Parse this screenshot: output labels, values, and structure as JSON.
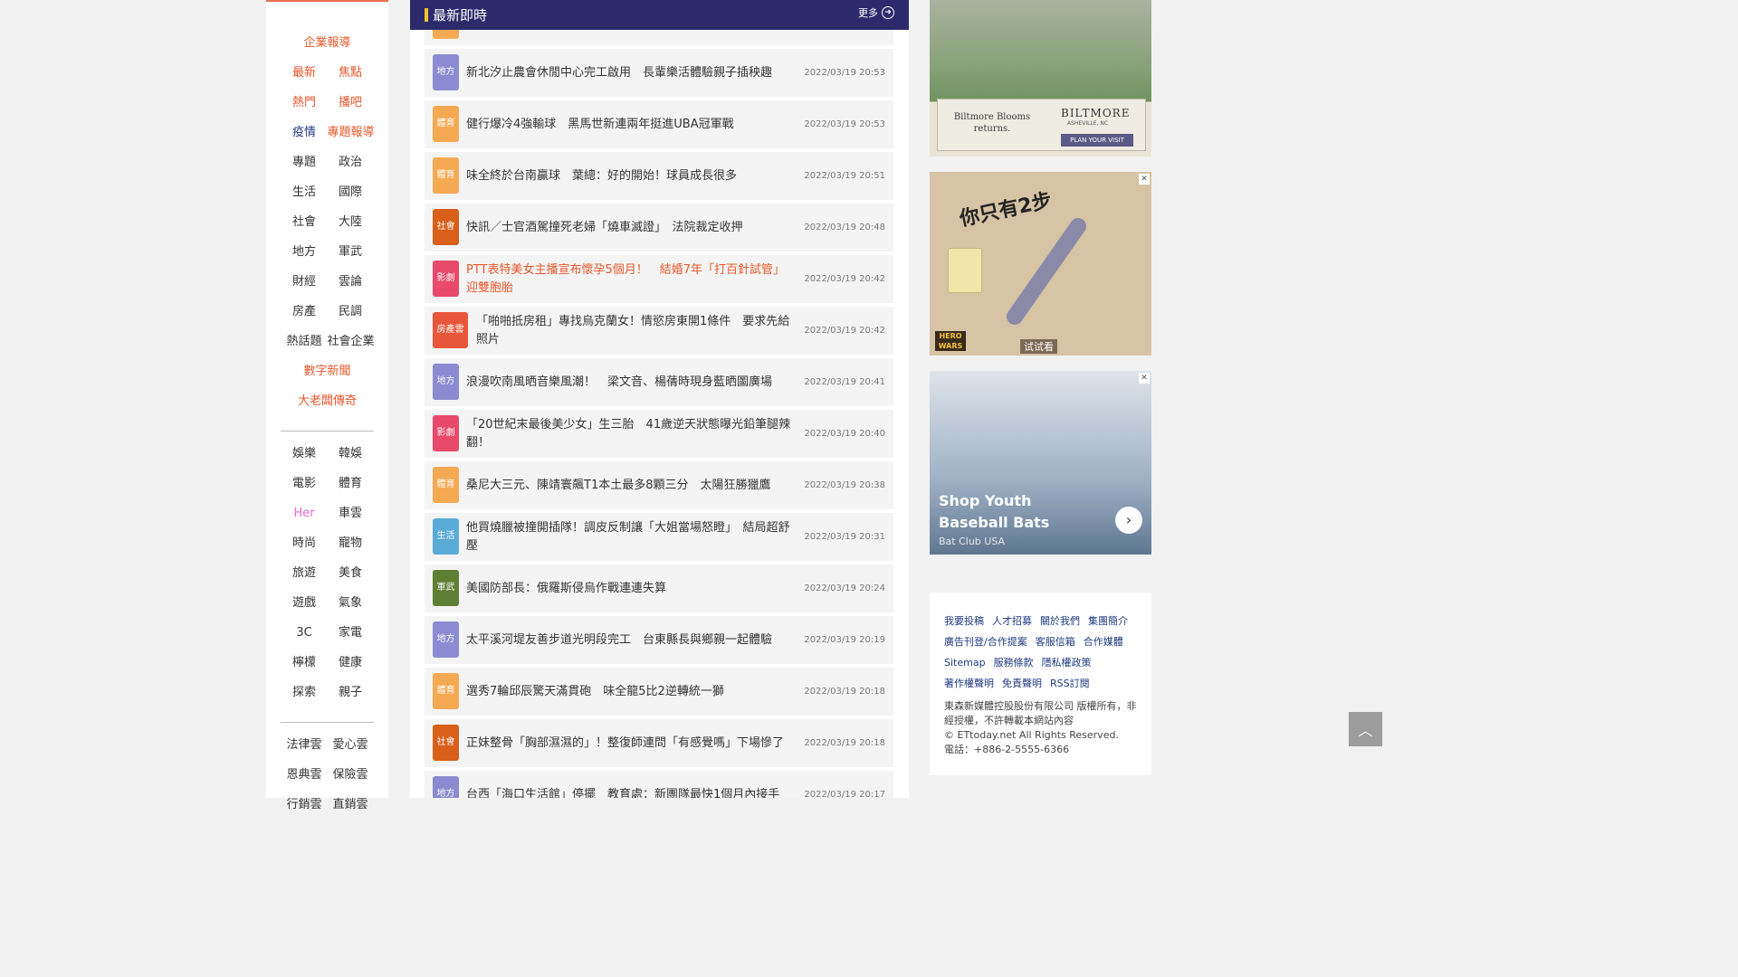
{
  "sidebar": {
    "groups": [
      [
        {
          "type": "single",
          "items": [
            {
              "label": "企業報導",
              "color": "orange"
            }
          ]
        },
        {
          "type": "pair",
          "items": [
            {
              "label": "最新",
              "color": "orange"
            },
            {
              "label": "焦點",
              "color": "orange"
            }
          ]
        },
        {
          "type": "pair",
          "items": [
            {
              "label": "熱門",
              "color": "orange"
            },
            {
              "label": "播吧",
              "color": "orange"
            }
          ]
        },
        {
          "type": "pair",
          "items": [
            {
              "label": "疫情",
              "color": "navy"
            },
            {
              "label": "專題報導",
              "color": "orange"
            }
          ]
        },
        {
          "type": "pair",
          "items": [
            {
              "label": "專題",
              "color": "dark"
            },
            {
              "label": "政治",
              "color": "dark"
            }
          ]
        },
        {
          "type": "pair",
          "items": [
            {
              "label": "生活",
              "color": "dark"
            },
            {
              "label": "國際",
              "color": "dark"
            }
          ]
        },
        {
          "type": "pair",
          "items": [
            {
              "label": "社會",
              "color": "dark"
            },
            {
              "label": "大陸",
              "color": "dark"
            }
          ]
        },
        {
          "type": "pair",
          "items": [
            {
              "label": "地方",
              "color": "dark"
            },
            {
              "label": "軍武",
              "color": "dark"
            }
          ]
        },
        {
          "type": "pair",
          "items": [
            {
              "label": "財經",
              "color": "dark"
            },
            {
              "label": "雲論",
              "color": "dark"
            }
          ]
        },
        {
          "type": "pair",
          "items": [
            {
              "label": "房產",
              "color": "dark"
            },
            {
              "label": "民調",
              "color": "dark"
            }
          ]
        },
        {
          "type": "pair",
          "items": [
            {
              "label": "熱話題",
              "color": "dark"
            },
            {
              "label": "社會企業",
              "color": "dark"
            }
          ]
        },
        {
          "type": "single",
          "items": [
            {
              "label": "數字新聞",
              "color": "orange"
            }
          ]
        },
        {
          "type": "single",
          "items": [
            {
              "label": "大老闆傳奇",
              "color": "orange"
            }
          ]
        }
      ],
      [
        {
          "type": "pair",
          "items": [
            {
              "label": "娛樂",
              "color": "dark"
            },
            {
              "label": "韓娛",
              "color": "dark"
            }
          ]
        },
        {
          "type": "pair",
          "items": [
            {
              "label": "電影",
              "color": "dark"
            },
            {
              "label": "體育",
              "color": "dark"
            }
          ]
        },
        {
          "type": "pair",
          "items": [
            {
              "label": "Her",
              "color": "pink"
            },
            {
              "label": "車雲",
              "color": "dark"
            }
          ]
        },
        {
          "type": "pair",
          "items": [
            {
              "label": "時尚",
              "color": "dark"
            },
            {
              "label": "寵物",
              "color": "dark"
            }
          ]
        },
        {
          "type": "pair",
          "items": [
            {
              "label": "旅遊",
              "color": "dark"
            },
            {
              "label": "美食",
              "color": "dark"
            }
          ]
        },
        {
          "type": "pair",
          "items": [
            {
              "label": "遊戲",
              "color": "dark"
            },
            {
              "label": "氣象",
              "color": "dark"
            }
          ]
        },
        {
          "type": "pair",
          "items": [
            {
              "label": "3C",
              "color": "dark"
            },
            {
              "label": "家電",
              "color": "dark"
            }
          ]
        },
        {
          "type": "pair",
          "items": [
            {
              "label": "檸檬",
              "color": "dark"
            },
            {
              "label": "健康",
              "color": "dark"
            }
          ]
        },
        {
          "type": "pair",
          "items": [
            {
              "label": "探索",
              "color": "dark"
            },
            {
              "label": "親子",
              "color": "dark"
            }
          ]
        }
      ],
      [
        {
          "type": "pair",
          "items": [
            {
              "label": "法律雲",
              "color": "dark"
            },
            {
              "label": "愛心雲",
              "color": "dark"
            }
          ]
        },
        {
          "type": "pair",
          "items": [
            {
              "label": "恩典雲",
              "color": "dark"
            },
            {
              "label": "保險雲",
              "color": "dark"
            }
          ]
        },
        {
          "type": "pair",
          "items": [
            {
              "label": "行銷雲",
              "color": "dark"
            },
            {
              "label": "直銷雲",
              "color": "dark"
            }
          ]
        }
      ]
    ]
  },
  "main": {
    "title": "最新即時",
    "more_label": "更多",
    "news": [
      {
        "tag": "地方",
        "tag_type": "local",
        "title": "新北汐止農會休閒中心完工啟用　長輩樂活體驗親子插秧趣",
        "date": "2022/03/19 20:53"
      },
      {
        "tag": "體育",
        "tag_type": "sport",
        "title": "健行爆冷4強輸球　黑馬世新連兩年挺進UBA冠軍戰",
        "date": "2022/03/19 20:53"
      },
      {
        "tag": "體育",
        "tag_type": "sport",
        "title": "味全終於台南贏球　葉總：好的開始！球員成長很多",
        "date": "2022/03/19 20:51"
      },
      {
        "tag": "社會",
        "tag_type": "society",
        "title": "快訊／士官酒駕撞死老婦「燒車滅證」　法院裁定收押",
        "date": "2022/03/19 20:48"
      },
      {
        "tag": "影劇",
        "tag_type": "ent",
        "title": "PTT表特美女主播宣布懷孕5個月！　結婚7年「打百針試管」迎雙胞胎",
        "date": "2022/03/19 20:42",
        "highlight": true
      },
      {
        "tag": "房產雲",
        "tag_type": "house",
        "title": "「啪啪抵房租」專找烏克蘭女！情慾房東開1條件　要求先給照片",
        "date": "2022/03/19 20:42"
      },
      {
        "tag": "地方",
        "tag_type": "local",
        "title": "浪漫吹南風晒音樂風潮！　梁文音、楊蒨時現身藍晒圖廣場",
        "date": "2022/03/19 20:41"
      },
      {
        "tag": "影劇",
        "tag_type": "ent",
        "title": "「20世紀末最後美少女」生三胎　41歲逆天狀態曝光鉛筆腿辣翻！",
        "date": "2022/03/19 20:40"
      },
      {
        "tag": "體育",
        "tag_type": "sport",
        "title": "桑尼大三元、陳靖寰飆T1本土最多8顆三分　太陽狂勝獵鷹",
        "date": "2022/03/19 20:38"
      },
      {
        "tag": "生活",
        "tag_type": "life",
        "title": "他買燒臘被撞開插隊！調皮反制讓「大姐當場怒瞪」　結局超舒壓",
        "date": "2022/03/19 20:31"
      },
      {
        "tag": "軍武",
        "tag_type": "mil",
        "title": "美國防部長：俄羅斯侵烏作戰連連失算",
        "date": "2022/03/19 20:24"
      },
      {
        "tag": "地方",
        "tag_type": "local",
        "title": "太平溪河堤友善步道光明段完工　台東縣長與鄉親一起體驗",
        "date": "2022/03/19 20:19"
      },
      {
        "tag": "體育",
        "tag_type": "sport",
        "title": "選秀7輪邱辰驚天滿貫砲　味全龍5比2逆轉統一獅",
        "date": "2022/03/19 20:18"
      },
      {
        "tag": "社會",
        "tag_type": "society",
        "title": "正妹整骨「胸部濕濕的」！整復師連問「有感覺嗎」下場慘了",
        "date": "2022/03/19 20:18"
      },
      {
        "tag": "地方",
        "tag_type": "local",
        "title": "台西「海口生活館」停擺　教育處：新團隊最快1個月內接手",
        "date": "2022/03/19 20:17"
      }
    ]
  },
  "ads": {
    "biltmore": {
      "text1": "Biltmore Blooms returns.",
      "brand": "BILTMORE",
      "location": "ASHEVILLE, NC",
      "cta": "PLAN YOUR VISIT"
    },
    "game": {
      "headline": "你只有2步",
      "logo": "HERO WARS",
      "cta": "试试看",
      "close_icon": "close-icon"
    },
    "baseball": {
      "title": "Shop Youth Baseball Bats",
      "advertiser": "Bat Club USA"
    }
  },
  "footer": {
    "links": [
      "我要投稿",
      "人才招募",
      "關於我們",
      "集團簡介",
      "廣告刊登/合作提案",
      "客服信箱",
      "合作媒體",
      "Sitemap",
      "服務條款",
      "隱私權政策",
      "著作權聲明",
      "免責聲明",
      "RSS訂閱"
    ],
    "copyright": "東森新媒體控股股份有限公司 版權所有，非經授權，不許轉載本網站內容",
    "rights": "© ETtoday.net All Rights Reserved.",
    "phone": "電話：+886-2-5555-6366"
  },
  "colors": {
    "accent": "#e8572a",
    "header": "#2c2a6b",
    "navy": "#1f3a80"
  },
  "back_to_top_icon": "chevron-up-icon"
}
